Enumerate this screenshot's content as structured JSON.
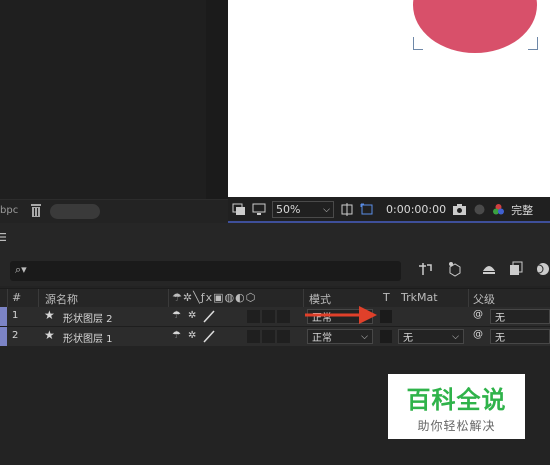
{
  "project_panel": {
    "bpc_label": "bpc"
  },
  "viewer_toolbar": {
    "zoom": "50%",
    "timecode": "0:00:00:00",
    "quality": "完整"
  },
  "timeline": {
    "search": {
      "placeholder": ""
    },
    "columns": {
      "num": "#",
      "source_name": "源名称",
      "mode": "模式",
      "t": "T",
      "trkmat": "TrkMat",
      "parent": "父级"
    },
    "layers": [
      {
        "num": "1",
        "name": "形状图层 2",
        "mode": "正常",
        "trkmat": "",
        "parent": "无"
      },
      {
        "num": "2",
        "name": "形状图层 1",
        "mode": "正常",
        "trkmat": "无",
        "parent": "无"
      }
    ]
  },
  "watermark": {
    "title": "百科全说",
    "subtitle": "助你轻松解决"
  },
  "colors": {
    "layer_label": "#7c84c6",
    "circle": "#d8506a",
    "accent_line": "#3e4f9a",
    "arrow": "#e0402a",
    "watermark_text": "#2fb34a"
  }
}
